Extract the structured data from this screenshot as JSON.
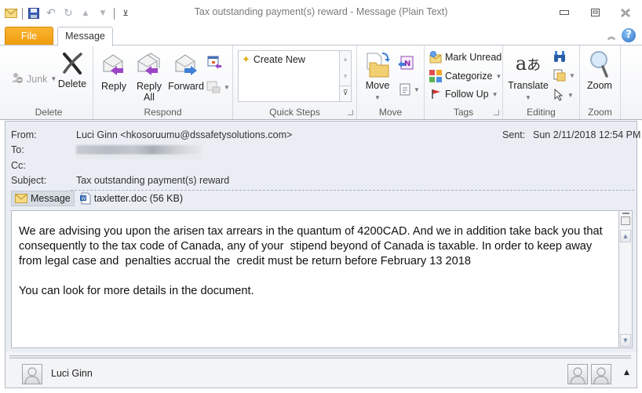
{
  "window": {
    "title": "Tax outstanding payment(s) reward  -  Message (Plain Text)",
    "controls": {
      "minimize": "minimize",
      "restore": "restore",
      "close": "close"
    }
  },
  "quick_access": {
    "items": [
      "mail-icon",
      "save-icon",
      "undo-icon",
      "redo-icon",
      "previous-item-icon",
      "next-item-icon",
      "customize-icon"
    ]
  },
  "tabs": {
    "file": "File",
    "message": "Message"
  },
  "ribbon": {
    "groups": {
      "delete": {
        "label": "Delete",
        "junk": "Junk",
        "delete": "Delete"
      },
      "respond": {
        "label": "Respond",
        "reply": "Reply",
        "reply_all_1": "Reply",
        "reply_all_2": "All",
        "forward": "Forward"
      },
      "quick_steps": {
        "label": "Quick Steps",
        "create_new": "Create New"
      },
      "move": {
        "label": "Move",
        "move": "Move"
      },
      "tags": {
        "label": "Tags",
        "mark_unread": "Mark Unread",
        "categorize": "Categorize",
        "follow_up": "Follow Up"
      },
      "editing": {
        "label": "Editing",
        "translate": "Translate"
      },
      "zoom": {
        "label": "Zoom",
        "zoom": "Zoom"
      }
    }
  },
  "header": {
    "from_label": "From:",
    "from_value": "Luci Ginn <hkosoruumu@dssafetysolutions.com>",
    "to_label": "To:",
    "cc_label": "Cc:",
    "subject_label": "Subject:",
    "subject_value": "Tax outstanding payment(s) reward",
    "sent_label": "Sent:",
    "sent_value": "Sun 2/11/2018 12:54 PM"
  },
  "attachments": {
    "message_tab": "Message",
    "file": "taxletter.doc (56 KB)"
  },
  "body": {
    "paragraph1": "We are advising you upon the arisen tax arrears in the quantum of 4200CAD. And we in addition take back you that consequently to the tax code of Canada, any of your  stipend beyond of Canada is taxable. In order to keep away from legal case and  penalties accrual the  credit must be return before February 13 2018",
    "paragraph2": "You can look for more details in the document."
  },
  "people_pane": {
    "name": "Luci Ginn"
  }
}
